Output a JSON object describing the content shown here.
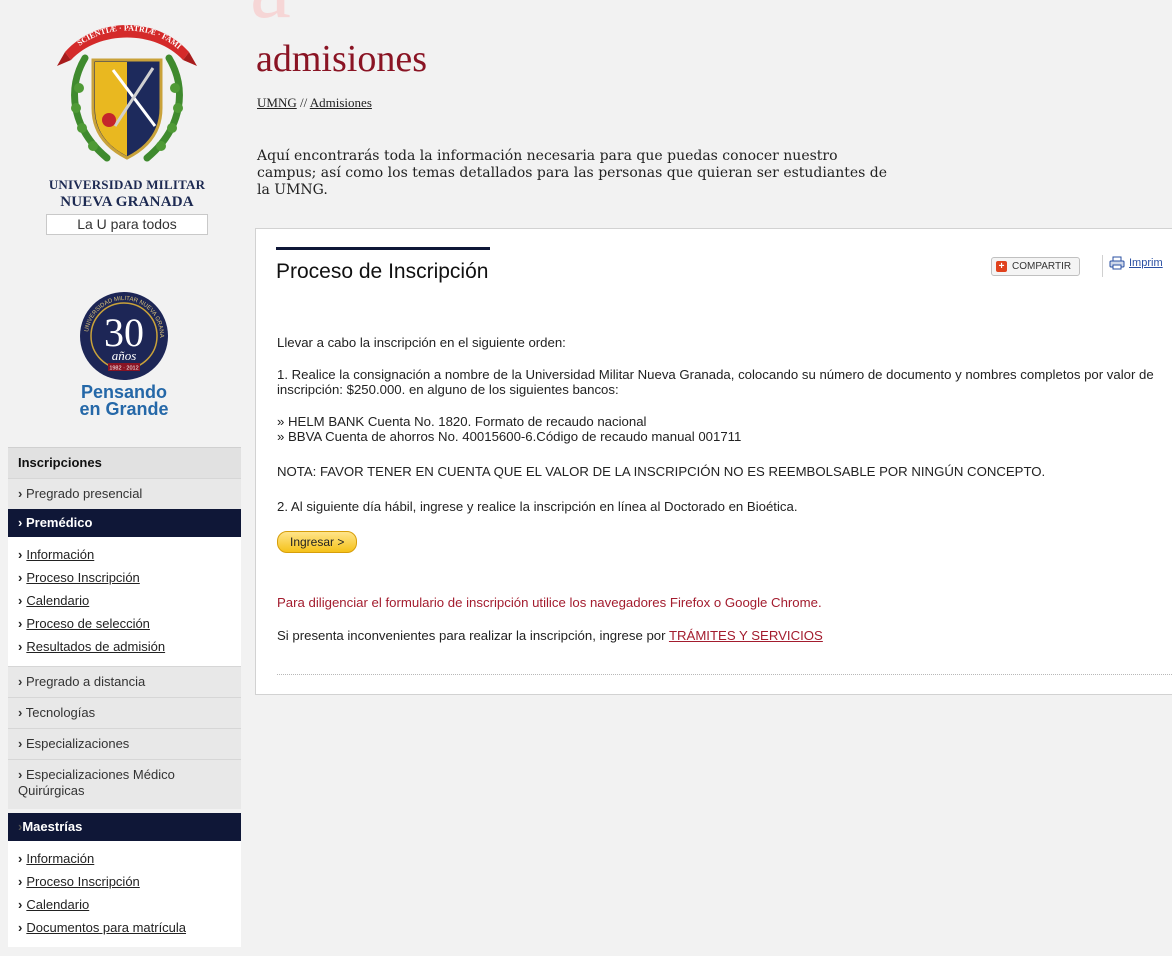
{
  "header": {
    "bg_letter": "a",
    "title": "admisiones",
    "breadcrumb": {
      "home": "UMNG",
      "separator": "//",
      "current": "Admisiones"
    },
    "intro": "Aquí encontrarás toda la información necesaria para que puedas conocer nuestro campus; así como los temas detallados para las personas que quieran ser estudiantes de la UMNG."
  },
  "logo": {
    "motto": "SCIENTIÆ · PATRIÆ · FAMILIÆ",
    "name_line1": "UNIVERSIDAD MILITAR",
    "name_line2": "NUEVA GRANADA",
    "tagline": "La U para todos"
  },
  "anniversary": {
    "ring_text": "UNIVERSIDAD MILITAR NUEVA GRANADA",
    "number": "30",
    "word": "años",
    "years": "1982 · 2012",
    "slogan_line1": "Pensando",
    "slogan_line2": "en Grande"
  },
  "sidebar": {
    "heading": "Inscripciones",
    "items": [
      {
        "label": "Pregrado presencial"
      },
      {
        "label": "Premédico"
      },
      {
        "label": "Pregrado a distancia"
      },
      {
        "label": "Tecnologías"
      },
      {
        "label": "Especializaciones"
      },
      {
        "label": "Especializaciones Médico Quirúrgicas"
      },
      {
        "label": "Maestrías"
      }
    ],
    "premedico_sub": [
      "Información",
      "Proceso Inscripción",
      "Calendario",
      "Proceso de selección",
      "Resultados de admisión"
    ],
    "maestrias_sub": [
      "Información",
      "Proceso Inscripción",
      "Calendario",
      "Documentos para matrícula"
    ],
    "arrow": "›"
  },
  "content": {
    "section_title": "Proceso de Inscripción",
    "share_label": "COMPARTIR",
    "print_label": "Imprim",
    "lead": "Llevar a cabo la inscripción en el siguiente orden:",
    "step1": "1. Realice la consignación a nombre de la Universidad Militar Nueva Granada, colocando su número de documento y nombres completos por valor de inscripción: $250.000. en alguno de los siguientes bancos:",
    "bank_marker": "»",
    "banks": [
      "HELM BANK Cuenta No. 1820. Formato de recaudo nacional",
      "BBVA Cuenta de ahorros No. 40015600-6.Código de recaudo manual 001711"
    ],
    "note": "NOTA: FAVOR TENER EN CUENTA QUE EL VALOR DE LA INSCRIPCIÓN NO ES REEMBOLSABLE POR NINGÚN CONCEPTO.",
    "step2": "2. Al siguiente día hábil, ingrese y realice la inscripción en línea al Doctorado en Bioética.",
    "ingresar_label": "Ingresar  >",
    "browsers": "Para diligenciar el formulario de inscripción utilice los navegadores Firefox o Google Chrome.",
    "issues_text": "Si presenta inconvenientes para realizar la inscripción, ingrese por ",
    "issues_link": "TRÁMITES Y SERVICIOS"
  },
  "colors": {
    "title_red": "#8a1424",
    "navy": "#0f1737",
    "sidebar_bg": "#e8e8e8",
    "link_red": "#a31c2e",
    "button_yellow": "#f5c21a"
  }
}
